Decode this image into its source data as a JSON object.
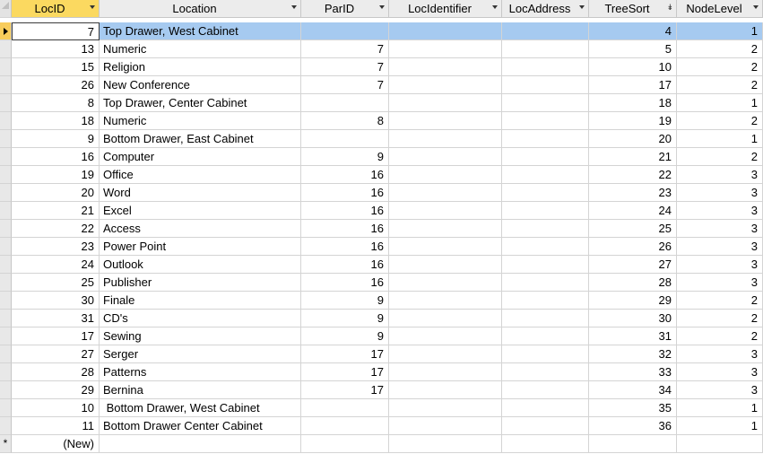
{
  "columns": [
    "LocID",
    "Location",
    "ParID",
    "LocIdentifier",
    "LocAddress",
    "TreeSort",
    "NodeLevel"
  ],
  "rows": [
    {
      "locid": "7",
      "location": "Top Drawer, West Cabinet",
      "parid": "",
      "locidentifier": "",
      "locaddress": "",
      "treesort": "4",
      "nodelevel": "1",
      "selected": true
    },
    {
      "locid": "13",
      "location": "Numeric",
      "parid": "7",
      "locidentifier": "",
      "locaddress": "",
      "treesort": "5",
      "nodelevel": "2"
    },
    {
      "locid": "15",
      "location": "Religion",
      "parid": "7",
      "locidentifier": "",
      "locaddress": "",
      "treesort": "10",
      "nodelevel": "2"
    },
    {
      "locid": "26",
      "location": "New Conference",
      "parid": "7",
      "locidentifier": "",
      "locaddress": "",
      "treesort": "17",
      "nodelevel": "2"
    },
    {
      "locid": "8",
      "location": "Top Drawer, Center Cabinet",
      "parid": "",
      "locidentifier": "",
      "locaddress": "",
      "treesort": "18",
      "nodelevel": "1"
    },
    {
      "locid": "18",
      "location": "Numeric",
      "parid": "8",
      "locidentifier": "",
      "locaddress": "",
      "treesort": "19",
      "nodelevel": "2"
    },
    {
      "locid": "9",
      "location": "Bottom Drawer, East Cabinet",
      "parid": "",
      "locidentifier": "",
      "locaddress": "",
      "treesort": "20",
      "nodelevel": "1"
    },
    {
      "locid": "16",
      "location": "Computer",
      "parid": "9",
      "locidentifier": "",
      "locaddress": "",
      "treesort": "21",
      "nodelevel": "2"
    },
    {
      "locid": "19",
      "location": "Office",
      "parid": "16",
      "locidentifier": "",
      "locaddress": "",
      "treesort": "22",
      "nodelevel": "3"
    },
    {
      "locid": "20",
      "location": "Word",
      "parid": "16",
      "locidentifier": "",
      "locaddress": "",
      "treesort": "23",
      "nodelevel": "3"
    },
    {
      "locid": "21",
      "location": "Excel",
      "parid": "16",
      "locidentifier": "",
      "locaddress": "",
      "treesort": "24",
      "nodelevel": "3"
    },
    {
      "locid": "22",
      "location": "Access",
      "parid": "16",
      "locidentifier": "",
      "locaddress": "",
      "treesort": "25",
      "nodelevel": "3"
    },
    {
      "locid": "23",
      "location": "Power Point",
      "parid": "16",
      "locidentifier": "",
      "locaddress": "",
      "treesort": "26",
      "nodelevel": "3"
    },
    {
      "locid": "24",
      "location": "Outlook",
      "parid": "16",
      "locidentifier": "",
      "locaddress": "",
      "treesort": "27",
      "nodelevel": "3"
    },
    {
      "locid": "25",
      "location": "Publisher",
      "parid": "16",
      "locidentifier": "",
      "locaddress": "",
      "treesort": "28",
      "nodelevel": "3"
    },
    {
      "locid": "30",
      "location": "Finale",
      "parid": "9",
      "locidentifier": "",
      "locaddress": "",
      "treesort": "29",
      "nodelevel": "2"
    },
    {
      "locid": "31",
      "location": "CD's",
      "parid": "9",
      "locidentifier": "",
      "locaddress": "",
      "treesort": "30",
      "nodelevel": "2"
    },
    {
      "locid": "17",
      "location": "Sewing",
      "parid": "9",
      "locidentifier": "",
      "locaddress": "",
      "treesort": "31",
      "nodelevel": "2"
    },
    {
      "locid": "27",
      "location": "Serger",
      "parid": "17",
      "locidentifier": "",
      "locaddress": "",
      "treesort": "32",
      "nodelevel": "3"
    },
    {
      "locid": "28",
      "location": "Patterns",
      "parid": "17",
      "locidentifier": "",
      "locaddress": "",
      "treesort": "33",
      "nodelevel": "3"
    },
    {
      "locid": "29",
      "location": "Bernina",
      "parid": "17",
      "locidentifier": "",
      "locaddress": "",
      "treesort": "34",
      "nodelevel": "3"
    },
    {
      "locid": "10",
      "location": " Bottom Drawer, West Cabinet",
      "parid": "",
      "locidentifier": "",
      "locaddress": "",
      "treesort": "35",
      "nodelevel": "1"
    },
    {
      "locid": "11",
      "location": "Bottom Drawer Center Cabinet",
      "parid": "",
      "locidentifier": "",
      "locaddress": "",
      "treesort": "36",
      "nodelevel": "1"
    }
  ],
  "new_row": {
    "marker": "*",
    "label": "(New)"
  },
  "icons": {
    "column_dropdown": "chevron-down-icon",
    "sort_ascending": "sort-ascending-icon",
    "new_record": "asterisk-icon",
    "current_record": "record-pointer-icon"
  },
  "colors": {
    "sorted_header": "#fbd960",
    "selection": "#a6caf0",
    "header": "#ececec",
    "gridline": "#d4d4d4"
  }
}
